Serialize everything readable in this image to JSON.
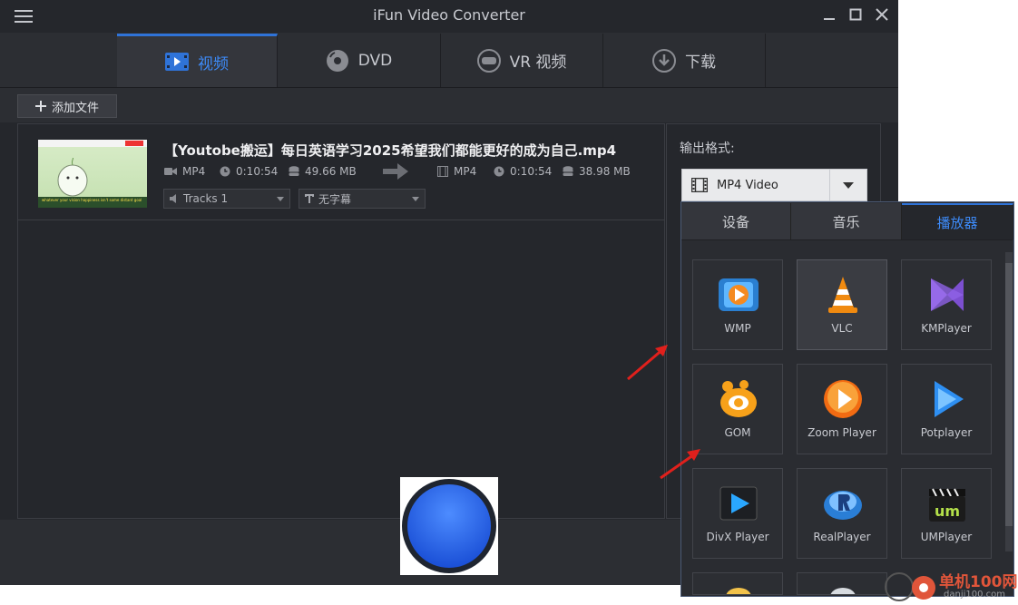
{
  "window": {
    "title": "iFun Video Converter"
  },
  "tabs": [
    {
      "label": "视频",
      "icon": "video-icon",
      "active": true
    },
    {
      "label": "DVD",
      "icon": "disc-icon",
      "active": false
    },
    {
      "label": "VR 视频",
      "icon": "vr-headset-icon",
      "active": false
    },
    {
      "label": "下载",
      "icon": "download-icon",
      "active": false
    }
  ],
  "toolbar": {
    "add_file_label": "添加文件"
  },
  "file": {
    "name": "【Youtobe搬运】每日英语学习2025希望我们都能更好的成为自己.mp4",
    "thumb_caption": "whatever your vision happiness isn't some distant goal",
    "source": {
      "format": "MP4",
      "duration": "0:10:54",
      "size": "49.66 MB"
    },
    "target": {
      "format": "MP4",
      "duration": "0:10:54",
      "size": "38.98 MB"
    },
    "audio_track": "Tracks 1",
    "subtitle": "无字幕"
  },
  "output": {
    "label": "输出格式:",
    "selected": "MP4 Video"
  },
  "format_panel": {
    "tabs": [
      {
        "label": "设备",
        "active": false
      },
      {
        "label": "音乐",
        "active": false
      },
      {
        "label": "播放器",
        "active": true
      }
    ],
    "players": [
      {
        "label": "WMP",
        "icon": "wmp-icon",
        "selected": false
      },
      {
        "label": "VLC",
        "icon": "vlc-cone-icon",
        "selected": true
      },
      {
        "label": "KMPlayer",
        "icon": "kmplayer-icon",
        "selected": false
      },
      {
        "label": "GOM",
        "icon": "gom-icon",
        "selected": false
      },
      {
        "label": "Zoom Player",
        "icon": "zoom-player-icon",
        "selected": false
      },
      {
        "label": "Potplayer",
        "icon": "potplayer-icon",
        "selected": false
      },
      {
        "label": "DivX Player",
        "icon": "divx-icon",
        "selected": false
      },
      {
        "label": "RealPlayer",
        "icon": "realplayer-icon",
        "selected": false
      },
      {
        "label": "UMPlayer",
        "icon": "umplayer-icon",
        "selected": false
      }
    ]
  },
  "watermark": {
    "text": "单机100网",
    "url": "danji100.com"
  },
  "colors": {
    "accent": "#3d8af7",
    "background": "#25272c",
    "annotation_arrow": "#e0201c"
  }
}
